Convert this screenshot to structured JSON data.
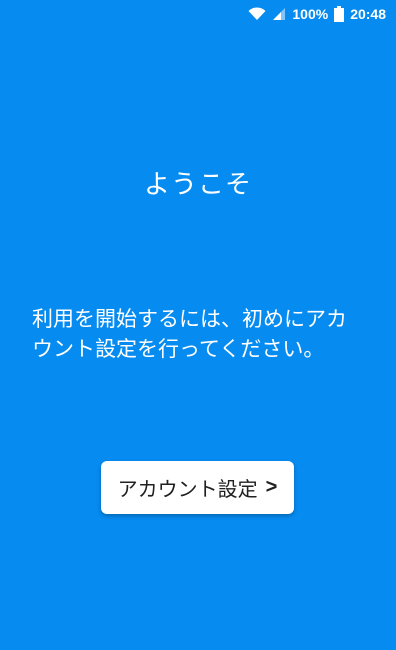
{
  "status_bar": {
    "battery_percent": "100%",
    "time": "20:48",
    "icons": [
      "wifi-icon",
      "signal-icon",
      "battery-icon"
    ]
  },
  "welcome": {
    "title": "ようこそ"
  },
  "message": {
    "line1": "利用を開始するには、初めにアカ",
    "line2": "ウント設定を行ってください。"
  },
  "setup_button": {
    "label": "アカウント設定",
    "chevron": ">"
  },
  "colors": {
    "background": "#068BF0",
    "button_bg": "#FFFFFF",
    "button_text": "#202020"
  }
}
